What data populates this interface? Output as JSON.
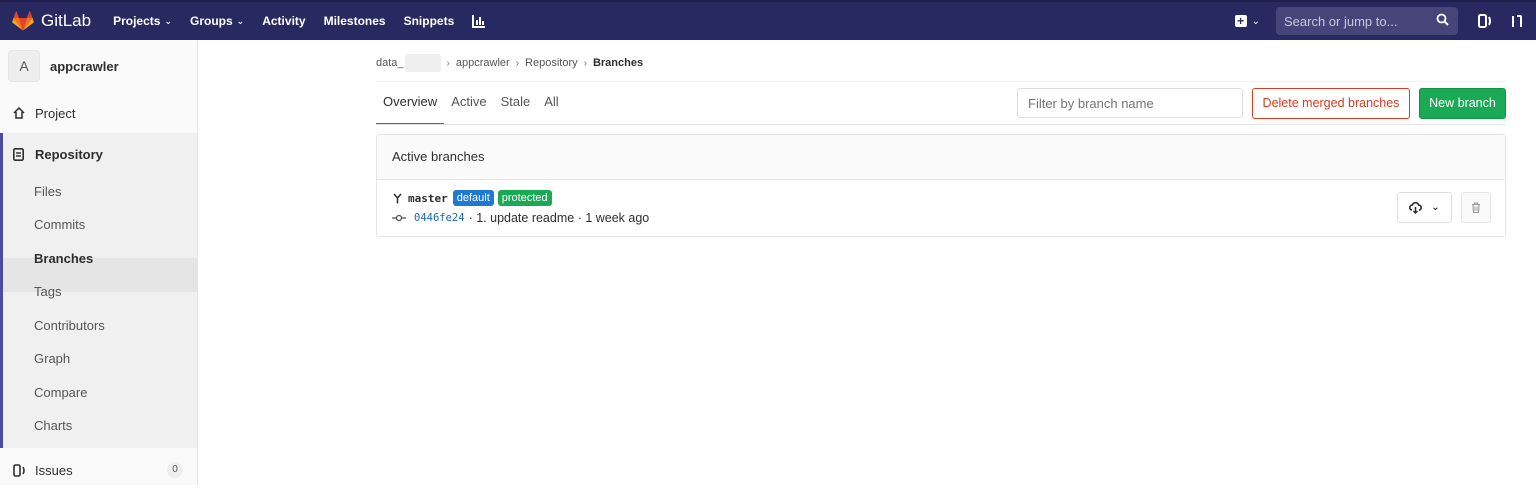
{
  "navbar": {
    "brand": "GitLab",
    "links": [
      {
        "label": "Projects",
        "dropdown": true
      },
      {
        "label": "Groups",
        "dropdown": true
      },
      {
        "label": "Activity",
        "dropdown": false
      },
      {
        "label": "Milestones",
        "dropdown": false
      },
      {
        "label": "Snippets",
        "dropdown": false
      }
    ],
    "search_placeholder": "Search or jump to...",
    "color": "#292961"
  },
  "sidebar": {
    "project_initial": "A",
    "project_name": "appcrawler",
    "project_label": "Project",
    "repository_label": "Repository",
    "repo_items": [
      "Files",
      "Commits",
      "Branches",
      "Tags",
      "Contributors",
      "Graph",
      "Compare",
      "Charts"
    ],
    "active_item": "Branches",
    "issues_label": "Issues",
    "issues_count": "0"
  },
  "breadcrumb": {
    "group": "data_",
    "project": "appcrawler",
    "section": "Repository",
    "current": "Branches"
  },
  "tabs": [
    {
      "label": "Overview",
      "active": true
    },
    {
      "label": "Active",
      "active": false
    },
    {
      "label": "Stale",
      "active": false
    },
    {
      "label": "All",
      "active": false
    }
  ],
  "filter": {
    "placeholder": "Filter by branch name"
  },
  "buttons": {
    "delete_merged": "Delete merged branches",
    "new_branch": "New branch"
  },
  "panel": {
    "title": "Active branches",
    "branches": [
      {
        "name": "master",
        "badges": [
          "default",
          "protected"
        ],
        "sha": "0446fe24",
        "commit_message": "1. update readme",
        "time": "1 week ago"
      }
    ]
  }
}
